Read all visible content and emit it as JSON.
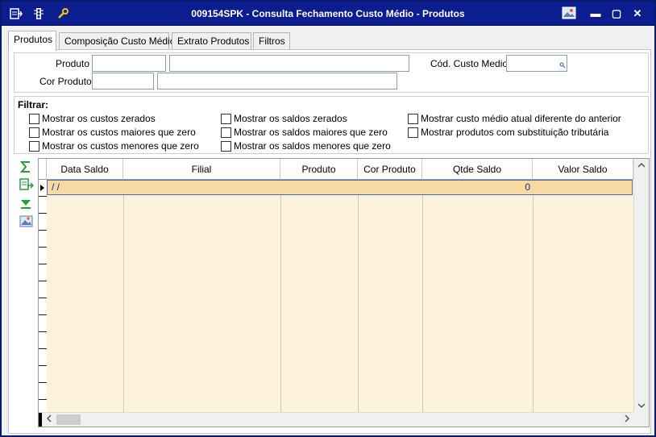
{
  "window": {
    "title": "009154SPK - Consulta Fechamento Custo Médio - Produtos",
    "controls": {
      "minimize": "▬",
      "maximize": "▢",
      "close": "✕"
    }
  },
  "tabs": [
    {
      "label": "Produtos",
      "active": true
    },
    {
      "label": "Composição Custo Médio",
      "active": false
    },
    {
      "label": "Extrato Produtos",
      "active": false
    },
    {
      "label": "Filtros",
      "active": false
    }
  ],
  "form": {
    "produto_label": "Produto",
    "cor_produto_label": "Cor Produto",
    "cod_custo_medio_label": "Cód. Custo Medio",
    "produto_code": "",
    "produto_desc": "",
    "cor_code": "",
    "cor_desc": "",
    "cod_custo_medio": ""
  },
  "filters": {
    "title": "Filtrar:",
    "options": [
      "Mostrar os custos zerados",
      "Mostrar os custos maiores que zero",
      "Mostrar os custos menores que zero",
      "Mostrar os saldos zerados",
      "Mostrar os saldos maiores que zero",
      "Mostrar os saldos menores que zero",
      "Mostrar custo médio atual diferente do anterior",
      "Mostrar produtos com substituição tributária"
    ]
  },
  "grid": {
    "columns": [
      "Data Saldo",
      "Filial",
      "Produto",
      "Cor Produto",
      "Qtde Saldo",
      "Valor Saldo"
    ],
    "rows": [
      {
        "data_saldo": "/ /",
        "filial": "",
        "produto": "",
        "cor_produto": "",
        "qtde_saldo": "0",
        "valor_saldo": ""
      }
    ]
  },
  "colors": {
    "titlebar": "#0b1d8f",
    "grid_background": "#fdf3dc",
    "selected_row": "#f8d9a0"
  }
}
